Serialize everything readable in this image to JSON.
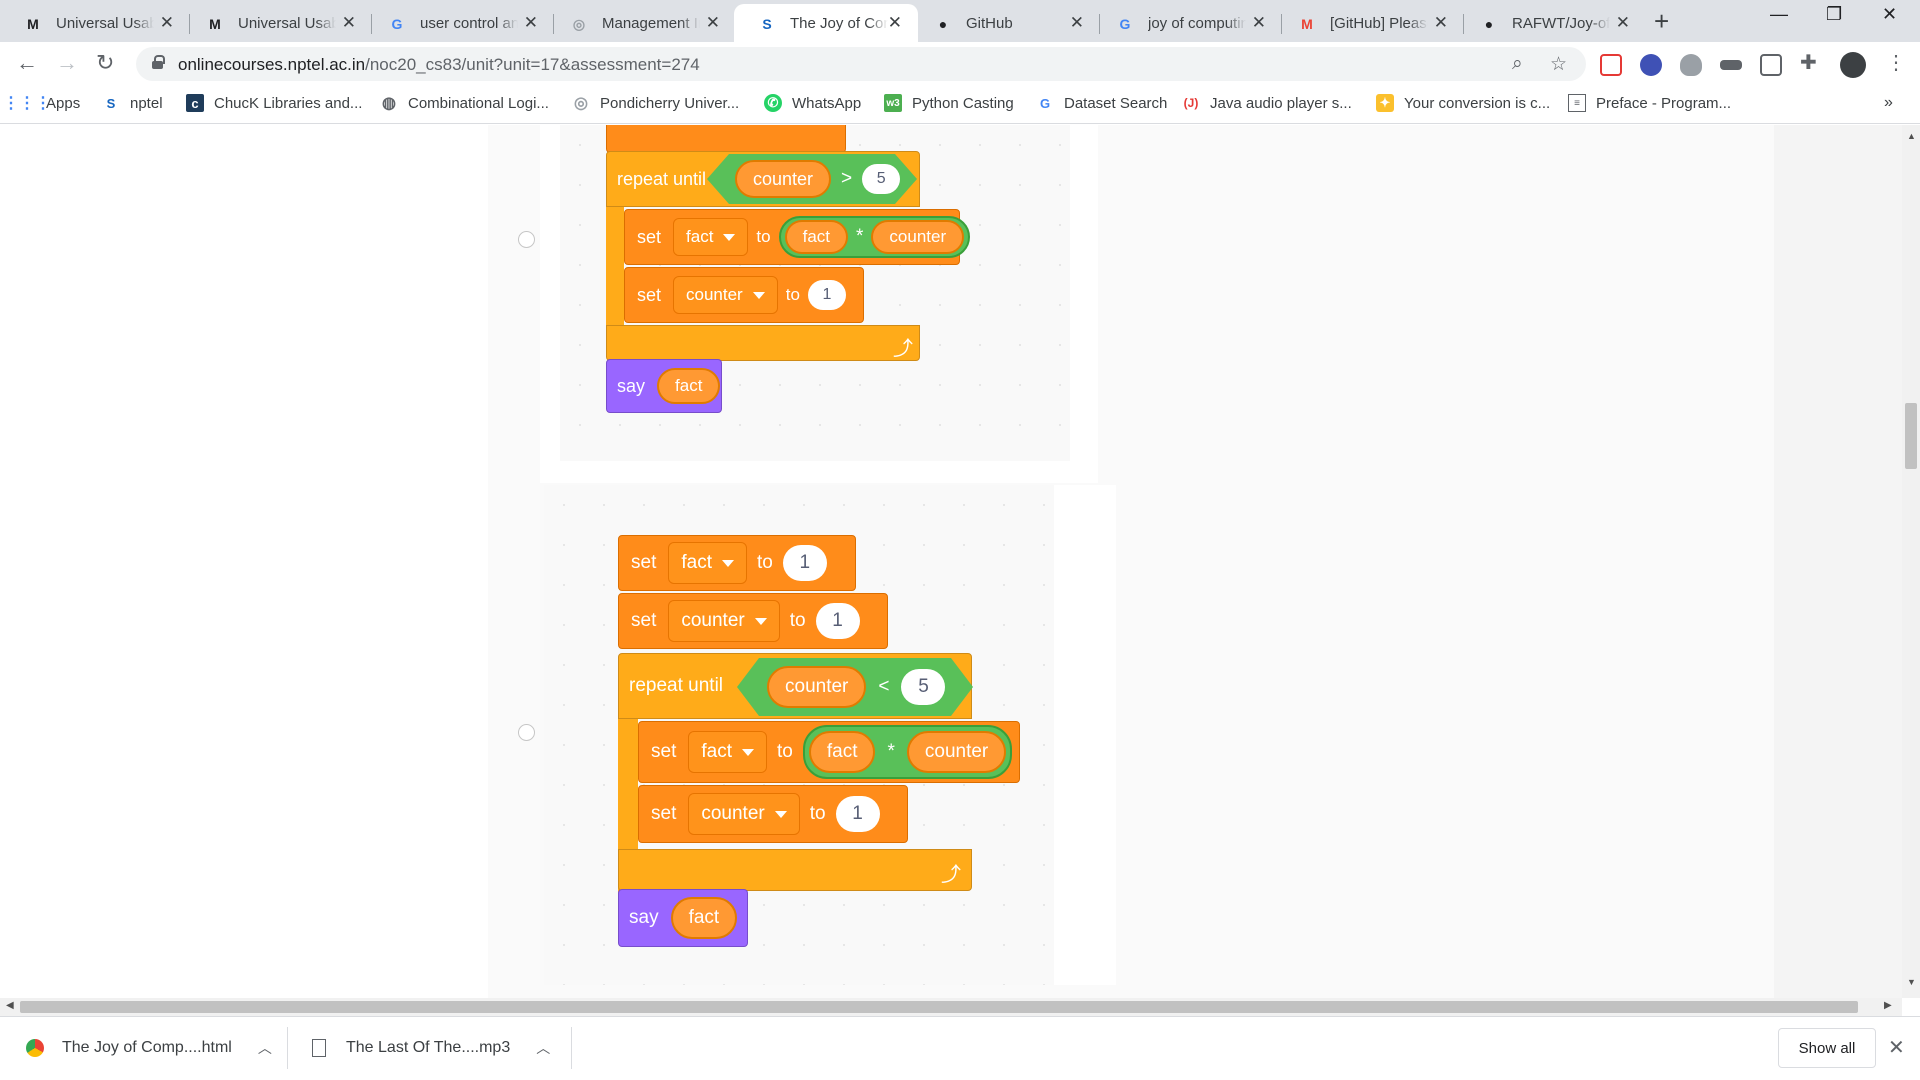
{
  "tabs": [
    {
      "title": "Universal Usability",
      "fav": "M",
      "favColor": "#202124"
    },
    {
      "title": "Universal Usability",
      "fav": "M",
      "favColor": "#202124"
    },
    {
      "title": "user control and",
      "fav": "G",
      "favColor": "#4285f4"
    },
    {
      "title": "Management Info",
      "fav": "◎",
      "favColor": "#9aa0a6"
    },
    {
      "title": "The Joy of Computing",
      "fav": "S",
      "favColor": "#1565c0"
    },
    {
      "title": "GitHub",
      "fav": "●",
      "favColor": "#202124"
    },
    {
      "title": "joy of computing",
      "fav": "G",
      "favColor": "#4285f4"
    },
    {
      "title": "[GitHub] Please",
      "fav": "M",
      "favColor": "#ea4335"
    },
    {
      "title": "RAFWT/Joy-of-",
      "fav": "●",
      "favColor": "#202124"
    }
  ],
  "address": {
    "host": "onlinecourses.nptel.ac.in",
    "path": "/noc20_cs83/unit?unit=17&assessment=274"
  },
  "bookmarks": [
    {
      "label": "Apps",
      "icon": "apps-grid-icon"
    },
    {
      "label": "nptel",
      "icon": "nptel-icon"
    },
    {
      "label": "ChucK Libraries and...",
      "icon": "chuck-icon"
    },
    {
      "label": "Combinational Logi...",
      "icon": "globe-icon"
    },
    {
      "label": "Pondicherry Univer...",
      "icon": "university-icon"
    },
    {
      "label": "WhatsApp",
      "icon": "whatsapp-icon"
    },
    {
      "label": "Python Casting",
      "icon": "w3-icon"
    },
    {
      "label": "Dataset Search",
      "icon": "google-icon"
    },
    {
      "label": "Java audio player s...",
      "icon": "java-icon"
    },
    {
      "label": "Your conversion is c...",
      "icon": "convert-icon"
    },
    {
      "label": "Preface - Program...",
      "icon": "book-icon"
    }
  ],
  "bookmarks_more": "»",
  "option1": {
    "repeat_label": "repeat until",
    "cond_var": "counter",
    "cond_op": ">",
    "cond_val": "5",
    "set1": {
      "kw": "set",
      "var": "fact",
      "to": "to",
      "a": "fact",
      "op": "*",
      "b": "counter"
    },
    "set2": {
      "kw": "set",
      "var": "counter",
      "to": "to",
      "val": "1"
    },
    "say": "say",
    "say_arg": "fact"
  },
  "option2": {
    "init1": {
      "kw": "set",
      "var": "fact",
      "to": "to",
      "val": "1"
    },
    "init2": {
      "kw": "set",
      "var": "counter",
      "to": "to",
      "val": "1"
    },
    "repeat_label": "repeat until",
    "cond_var": "counter",
    "cond_op": "<",
    "cond_val": "5",
    "set1": {
      "kw": "set",
      "var": "fact",
      "to": "to",
      "a": "fact",
      "op": "*",
      "b": "counter"
    },
    "set2": {
      "kw": "set",
      "var": "counter",
      "to": "to",
      "val": "1"
    },
    "say": "say",
    "say_arg": "fact"
  },
  "downloads": [
    {
      "name": "The Joy of Comp....html",
      "icon": "chrome-icon"
    },
    {
      "name": "The Last Of The....mp3",
      "icon": "audio-file-icon"
    }
  ],
  "show_all": "Show all",
  "colors": {
    "scratch_orange": "#ff8c1a",
    "scratch_loop": "#ffab19",
    "scratch_looks": "#9966ff",
    "scratch_operator": "#59c059"
  }
}
